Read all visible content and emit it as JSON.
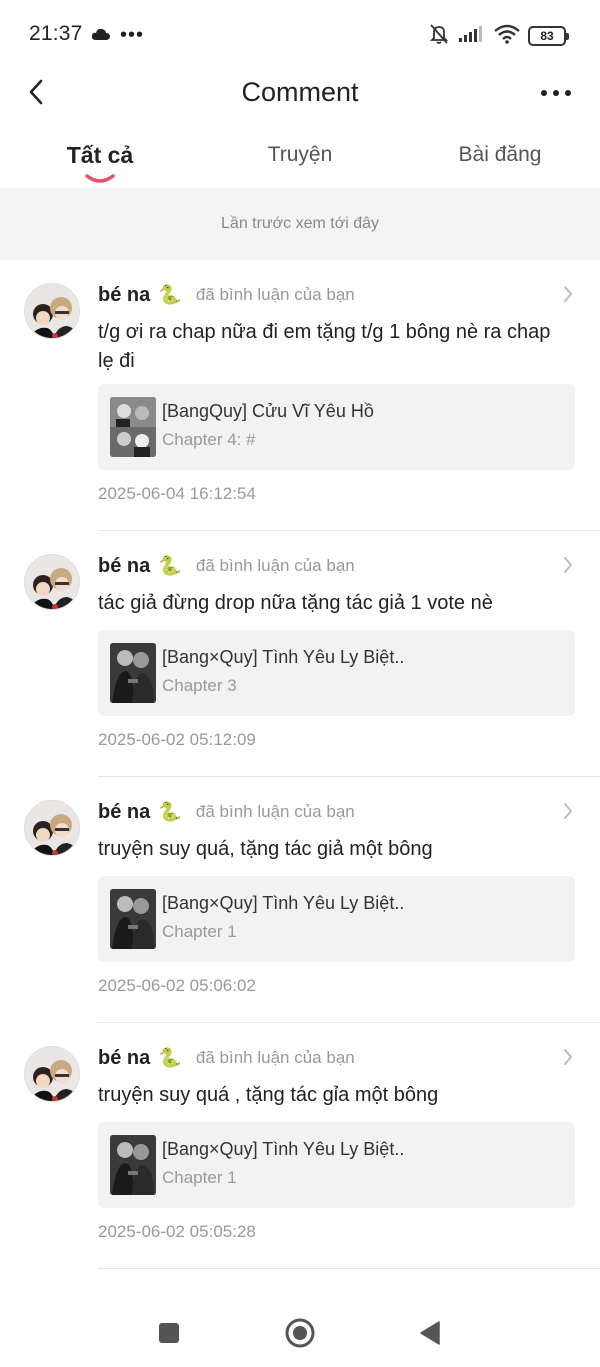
{
  "status_bar": {
    "time": "21:37",
    "battery": "83"
  },
  "header": {
    "title": "Comment"
  },
  "tabs": [
    {
      "label": "Tất cả",
      "active": true
    },
    {
      "label": "Truyện",
      "active": false
    },
    {
      "label": "Bài đăng",
      "active": false
    }
  ],
  "notice": "Lần trước xem tới đây",
  "comments": [
    {
      "user": "bé na",
      "emoji": "🐍",
      "action": "đã bình luận của bạn",
      "text": "t/g ơi ra chap nữa đi em tặng t/g 1 bông nè ra chap lẹ đi",
      "story_title": "[BangQuy] Cửu Vĩ Yêu Hồ",
      "chapter": "Chapter 4: #",
      "time": "2025-06-04 16:12:54"
    },
    {
      "user": "bé na",
      "emoji": "🐍",
      "action": "đã bình luận của bạn",
      "text": "tác giả đừng drop nữa tặng tác giả 1 vote nè",
      "story_title": "[Bang×Quy] Tình Yêu Ly Biệt..",
      "chapter": "Chapter 3",
      "time": "2025-06-02 05:12:09"
    },
    {
      "user": "bé na",
      "emoji": "🐍",
      "action": "đã bình luận của bạn",
      "text": "truyện suy quá, tặng tác giả một bông",
      "story_title": "[Bang×Quy] Tình Yêu Ly Biệt..",
      "chapter": "Chapter 1",
      "time": "2025-06-02 05:06:02"
    },
    {
      "user": "bé na",
      "emoji": "🐍",
      "action": "đã bình luận của bạn",
      "text": "truyện suy quá , tặng tác gỉa một bông",
      "story_title": "[Bang×Quy] Tình Yêu Ly Biệt..",
      "chapter": "Chapter 1",
      "time": "2025-06-02 05:05:28"
    }
  ],
  "colors": {
    "accent": "#e8506e",
    "muted": "#999999",
    "card_bg": "#f2f2f2"
  }
}
